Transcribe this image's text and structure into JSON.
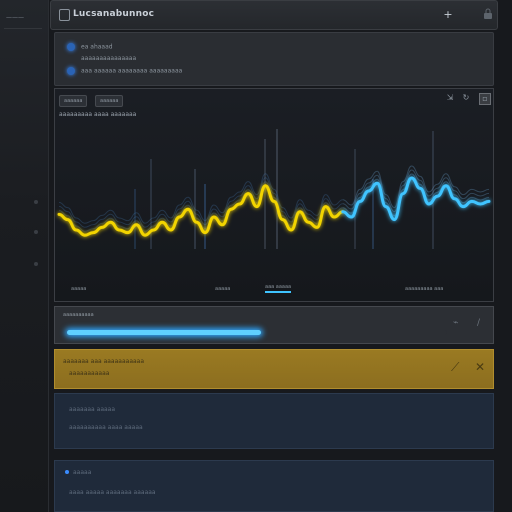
{
  "sidebar": {
    "label": "———"
  },
  "titlebar": {
    "title": "Lucsanabunnoc",
    "add_icon": "+",
    "lock_icon": "padlock"
  },
  "info": {
    "row1": "ea ahaaad",
    "row2": "aaaaaaaaaaaaaaa",
    "row3": "aaa aaaaaa aaaaaaaa aaaaaaaaa"
  },
  "chart": {
    "chips": [
      "aaaaaa",
      "aaaaaa"
    ],
    "subtitle": "aaaaaaaaa aaaa aaaaaaa",
    "footer": [
      "aaaaa",
      "aaaaa",
      "aaa aaaaa",
      "aaaaaaaaa aaa"
    ]
  },
  "chart_data": {
    "type": "line",
    "x": [
      0,
      1,
      2,
      3,
      4,
      5,
      6,
      7,
      8,
      9,
      10,
      11,
      12,
      13,
      14,
      15,
      16,
      17,
      18,
      19,
      20,
      21,
      22,
      23,
      24,
      25,
      26,
      27,
      28,
      29,
      30,
      31,
      32,
      33,
      34,
      35,
      36,
      37,
      38,
      39,
      40,
      41,
      42,
      43,
      44,
      45,
      46,
      47,
      48,
      49,
      50
    ],
    "series": [
      {
        "color": "#f2d400",
        "values": [
          0.42,
          0.38,
          0.3,
          0.26,
          0.28,
          0.32,
          0.36,
          0.3,
          0.28,
          0.34,
          0.26,
          0.3,
          0.36,
          0.3,
          0.4,
          0.46,
          0.36,
          0.28,
          0.4,
          0.34,
          0.46,
          0.5,
          0.58,
          0.48,
          0.64,
          0.52,
          0.38,
          0.3,
          0.44,
          0.36,
          0.32,
          0.48,
          0.4,
          0.44,
          null,
          null,
          null,
          null,
          null,
          null,
          null,
          null,
          null,
          null,
          null,
          null,
          null,
          null,
          null,
          null,
          null
        ]
      },
      {
        "color": "#3fc4ff",
        "values": [
          null,
          null,
          null,
          null,
          null,
          null,
          null,
          null,
          null,
          null,
          null,
          null,
          null,
          null,
          null,
          null,
          null,
          null,
          null,
          null,
          null,
          null,
          null,
          null,
          null,
          null,
          null,
          null,
          null,
          null,
          null,
          null,
          null,
          0.44,
          0.4,
          0.52,
          0.6,
          0.66,
          0.48,
          0.38,
          0.58,
          0.7,
          0.62,
          0.5,
          0.56,
          0.64,
          0.54,
          0.48,
          0.52,
          0.5,
          0.52
        ]
      }
    ]
  },
  "progress": {
    "label": "aaaaaaaaaa",
    "value_fraction": 0.51
  },
  "highlight_panel": {
    "line1": "aaaaaaa aaa aaaaaaaaaaa",
    "line2": "aaaaaaaaaaa"
  },
  "blue_panel_1": {
    "line1": "aaaaaaa aaaaa",
    "line2": "aaaaaaaaaa aaaa aaaaa"
  },
  "blue_panel_2": {
    "line1": "aaaaa",
    "line2": "aaaa aaaaa aaaaaaa aaaaaa"
  },
  "colors": {
    "accent_blue": "#3fc4ff",
    "accent_yellow": "#f2d400",
    "highlight_bg": "#9a7a22"
  }
}
